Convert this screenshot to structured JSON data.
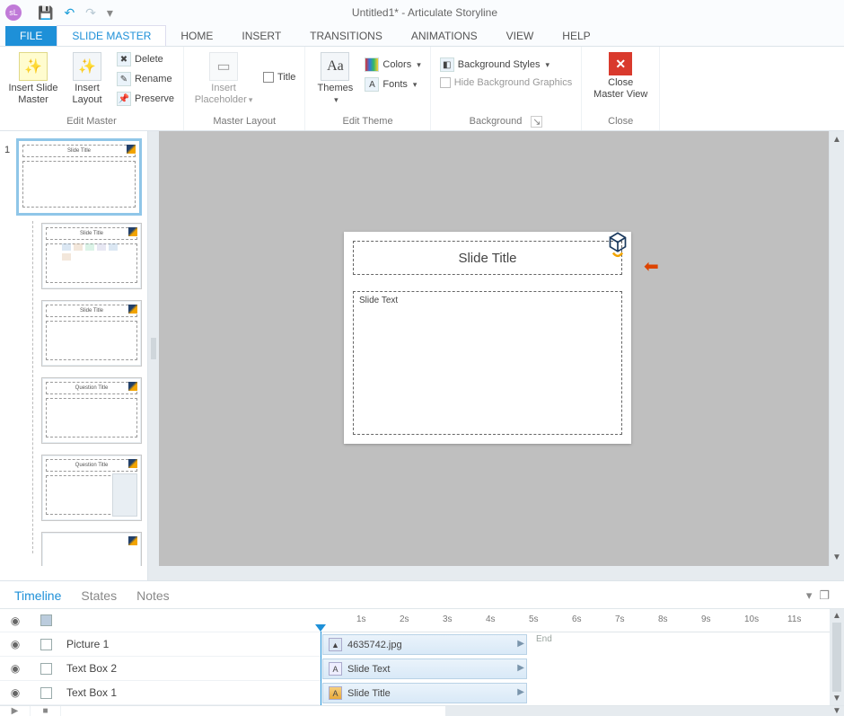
{
  "window": {
    "title": "Untitled1* - Articulate Storyline",
    "app_badge": "sL"
  },
  "qat": {
    "save": "💾",
    "undo": "↶",
    "redo": "↷",
    "more": "▾"
  },
  "tabs": {
    "file": "FILE",
    "slide_master": "SLIDE MASTER",
    "home": "HOME",
    "insert": "INSERT",
    "transitions": "TRANSITIONS",
    "animations": "ANIMATIONS",
    "view": "VIEW",
    "help": "HELP"
  },
  "ribbon": {
    "edit_master": {
      "label": "Edit Master",
      "insert_slide_master": "Insert Slide\nMaster",
      "insert_layout": "Insert\nLayout",
      "delete": "Delete",
      "rename": "Rename",
      "preserve": "Preserve"
    },
    "master_layout": {
      "label": "Master Layout",
      "insert_placeholder": "Insert\nPlaceholder",
      "title_chk": "Title"
    },
    "edit_theme": {
      "label": "Edit Theme",
      "themes": "Themes",
      "colors": "Colors",
      "fonts": "Fonts"
    },
    "background": {
      "label": "Background",
      "styles": "Background Styles",
      "hide": "Hide Background Graphics"
    },
    "close": {
      "label": "Close",
      "button": "Close\nMaster View"
    }
  },
  "thumbs": {
    "master_num": "1",
    "master_title": "Slide Title",
    "layouts": [
      {
        "title": "Slide Title",
        "has_body": true,
        "has_content_icons": true
      },
      {
        "title": "Slide Title",
        "has_body": true,
        "has_content_icons": false
      },
      {
        "title": "Question Title",
        "has_body": true,
        "has_content_icons": false
      },
      {
        "title": "Question Title",
        "has_body": true,
        "has_content_icons": false,
        "has_sidepanel": true
      },
      {
        "title": "",
        "has_body": false,
        "blank": true
      }
    ]
  },
  "canvas": {
    "title_placeholder": "Slide Title",
    "body_placeholder": "Slide Text"
  },
  "bottom": {
    "tabs": {
      "timeline": "Timeline",
      "states": "States",
      "notes": "Notes"
    },
    "ruler_ticks": [
      "1s",
      "2s",
      "3s",
      "4s",
      "5s",
      "6s",
      "7s",
      "8s",
      "9s",
      "10s",
      "11s"
    ],
    "end_label": "End",
    "rows": [
      {
        "name": "Picture 1",
        "clip_label": "4635742.jpg",
        "clip_icon": "img"
      },
      {
        "name": "Text Box 2",
        "clip_label": "Slide Text",
        "clip_icon": "txt"
      },
      {
        "name": "Text Box 1",
        "clip_label": "Slide Title",
        "clip_icon": "ttl"
      }
    ]
  }
}
